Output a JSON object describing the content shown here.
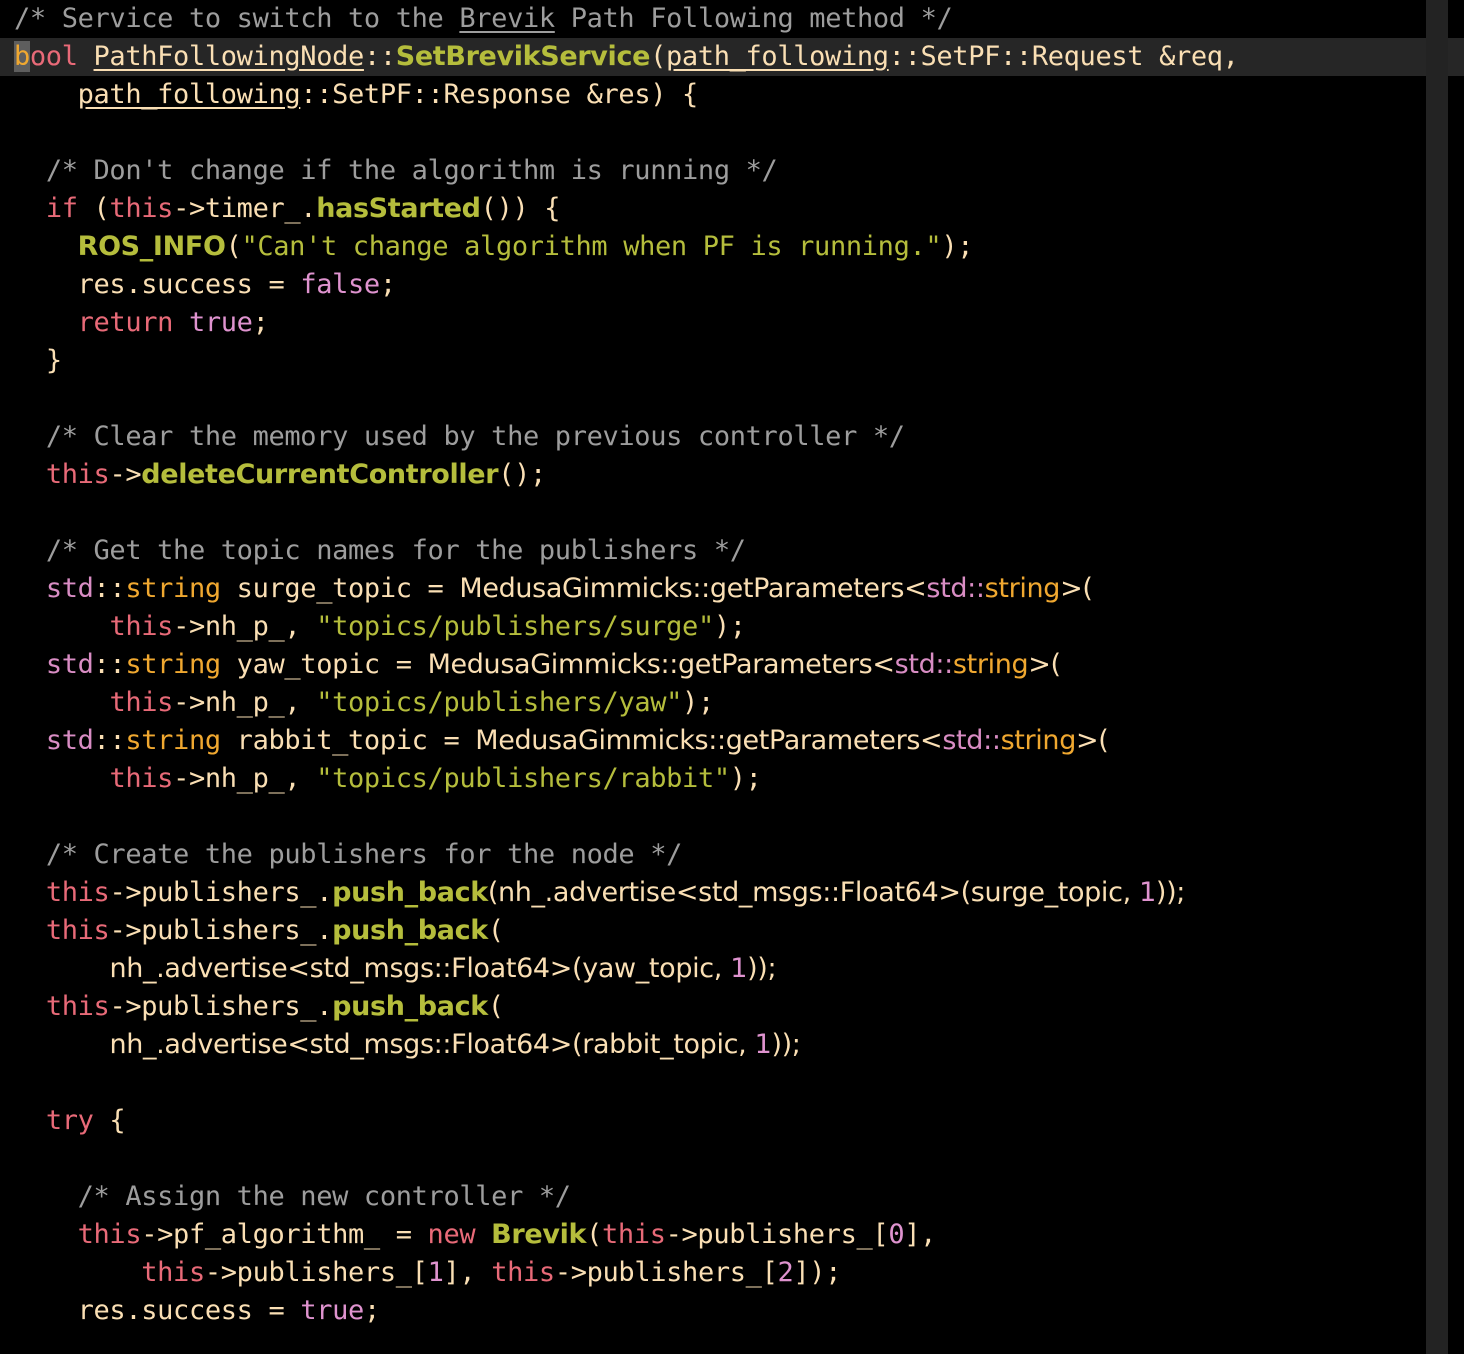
{
  "editor": {
    "language": "cpp",
    "theme_background": "#000000",
    "active_line_background": "#262626",
    "scrollbar_color": "#232323",
    "cursor_color": "#5e5e5e",
    "active_line_index": 1,
    "cursor_line": 2,
    "cursor_column": 1,
    "colors": {
      "comment": "#9d9d9d",
      "keyword": "#e86a78",
      "type": "#f0a830",
      "namespace": "#d98dc4",
      "constant": "#df93cf",
      "number": "#df93cf",
      "string": "#b5bd3c",
      "function": "#b5bd3c",
      "plain": "#fadfb4"
    }
  },
  "code": {
    "lines": [
      "/* Service to switch to the Brevik Path Following method */",
      "bool PathFollowingNode::SetBrevikService(path_following::SetPF::Request &req,",
      "    path_following::SetPF::Response &res) {",
      "",
      "  /* Don't change if the algorithm is running */",
      "  if (this->timer_.hasStarted()) {",
      "    ROS_INFO(\"Can't change algorithm when PF is running.\");",
      "    res.success = false;",
      "    return true;",
      "  }",
      "",
      "  /* Clear the memory used by the previous controller */",
      "  this->deleteCurrentController();",
      "",
      "  /* Get the topic names for the publishers */",
      "  std::string surge_topic = MedusaGimmicks::getParameters<std::string>(",
      "      this->nh_p_, \"topics/publishers/surge\");",
      "  std::string yaw_topic = MedusaGimmicks::getParameters<std::string>(",
      "      this->nh_p_, \"topics/publishers/yaw\");",
      "  std::string rabbit_topic = MedusaGimmicks::getParameters<std::string>(",
      "      this->nh_p_, \"topics/publishers/rabbit\");",
      "",
      "  /* Create the publishers for the node */",
      "  this->publishers_.push_back(nh_.advertise<std_msgs::Float64>(surge_topic, 1));",
      "  this->publishers_.push_back(",
      "      nh_.advertise<std_msgs::Float64>(yaw_topic, 1));",
      "  this->publishers_.push_back(",
      "      nh_.advertise<std_msgs::Float64>(rabbit_topic, 1));",
      "",
      "  try {",
      "",
      "    /* Assign the new controller */",
      "    this->pf_algorithm_ = new Brevik(this->publishers_[0],",
      "        this->publishers_[1], this->publishers_[2]);",
      "    res.success = true;"
    ]
  },
  "tokens": {
    "l0": {
      "comment": "/* Service to switch to the ",
      "spell": "Brevik",
      "comment2": " Path Following method */"
    },
    "l1": {
      "kw": "bool",
      "sp1": " ",
      "cls": "PathFollowingNode",
      "sep1": "::",
      "fn": "SetBrevikService",
      "p1": "(",
      "ns": "path_following",
      "sep2": "::SetPF::Request &req,",
      "cursor_char": "b",
      "kw_rest": "ool"
    },
    "l2": {
      "ns": "path_following",
      "rest": "::SetPF::Response &res) {"
    },
    "l4": {
      "comment": "/* Don't change if the algorithm is running */"
    },
    "l5": {
      "kw": "if",
      "mid": " (",
      "this": "this",
      "arrow": "->timer_.",
      "fn": "hasStarted",
      "end": "()) {"
    },
    "l6": {
      "fn": "ROS_INFO",
      "p": "(",
      "str": "\"Can't change algorithm when PF is running.\"",
      "end": ");"
    },
    "l7": {
      "plain": "res.success = ",
      "const": "false",
      "end": ";"
    },
    "l8": {
      "kw": "return",
      "sp": " ",
      "const": "true",
      "end": ";"
    },
    "l9": {
      "brace": "}"
    },
    "l11": {
      "comment": "/* Clear the memory used by the previous controller */"
    },
    "l12": {
      "this": "this",
      "arrow": "->",
      "fn": "deleteCurrentController",
      "end": "();"
    },
    "l14": {
      "comment": "/* Get the topic names for the publishers */"
    },
    "l15": {
      "ns": "std",
      "sep": "::",
      "type": "string",
      "ident": " surge_topic = ",
      "cls": "MedusaGimmicks::getParameters",
      "lt": "<",
      "ns2": "std",
      "sep2": "::",
      "type2": "string",
      "gt": ">("
    },
    "l16": {
      "this": "this",
      "arrow": "->nh_p_, ",
      "str": "\"topics/publishers/surge\"",
      "end": ");"
    },
    "l17": {
      "ns": "std",
      "sep": "::",
      "type": "string",
      "ident": " yaw_topic = ",
      "cls": "MedusaGimmicks::getParameters",
      "lt": "<",
      "ns2": "std",
      "sep2": "::",
      "type2": "string",
      "gt": ">("
    },
    "l18": {
      "this": "this",
      "arrow": "->nh_p_, ",
      "str": "\"topics/publishers/yaw\"",
      "end": ");"
    },
    "l19": {
      "ns": "std",
      "sep": "::",
      "type": "string",
      "ident": " rabbit_topic = ",
      "cls": "MedusaGimmicks::getParameters",
      "lt": "<",
      "ns2": "std",
      "sep2": "::",
      "type2": "string",
      "gt": ">("
    },
    "l20": {
      "this": "this",
      "arrow": "->nh_p_, ",
      "str": "\"topics/publishers/rabbit\"",
      "end": ");"
    },
    "l22": {
      "comment": "/* Create the publishers for the node */"
    },
    "l23": {
      "this": "this",
      "arrow": "->publishers_.",
      "fn": "push_back",
      "mid": "(nh_.advertise<std_msgs::Float64>(surge_topic, ",
      "num": "1",
      "end": "));"
    },
    "l24": {
      "this": "this",
      "arrow": "->publishers_.",
      "fn": "push_back",
      "end": "("
    },
    "l25": {
      "plain": "nh_.advertise<std_msgs::Float64>(yaw_topic, ",
      "num": "1",
      "end": "));"
    },
    "l26": {
      "this": "this",
      "arrow": "->publishers_.",
      "fn": "push_back",
      "end": "("
    },
    "l27": {
      "plain": "nh_.advertise<std_msgs::Float64>(rabbit_topic, ",
      "num": "1",
      "end": "));"
    },
    "l29": {
      "kw": "try",
      "end": " {"
    },
    "l31": {
      "comment": "/* Assign the new controller */"
    },
    "l32": {
      "this": "this",
      "arrow": "->pf_algorithm_ = ",
      "kw": "new",
      "sp": " ",
      "cls": "Brevik",
      "p": "(",
      "this2": "this",
      "arrow2": "->publishers_[",
      "num": "0",
      "end": "],"
    },
    "l33": {
      "this": "this",
      "arrow": "->publishers_[",
      "num": "1",
      "mid": "], ",
      "this2": "this",
      "arrow2": "->publishers_[",
      "num2": "2",
      "end": "]);"
    },
    "l34": {
      "plain": "res.success = ",
      "const": "true",
      "end": ";"
    }
  }
}
